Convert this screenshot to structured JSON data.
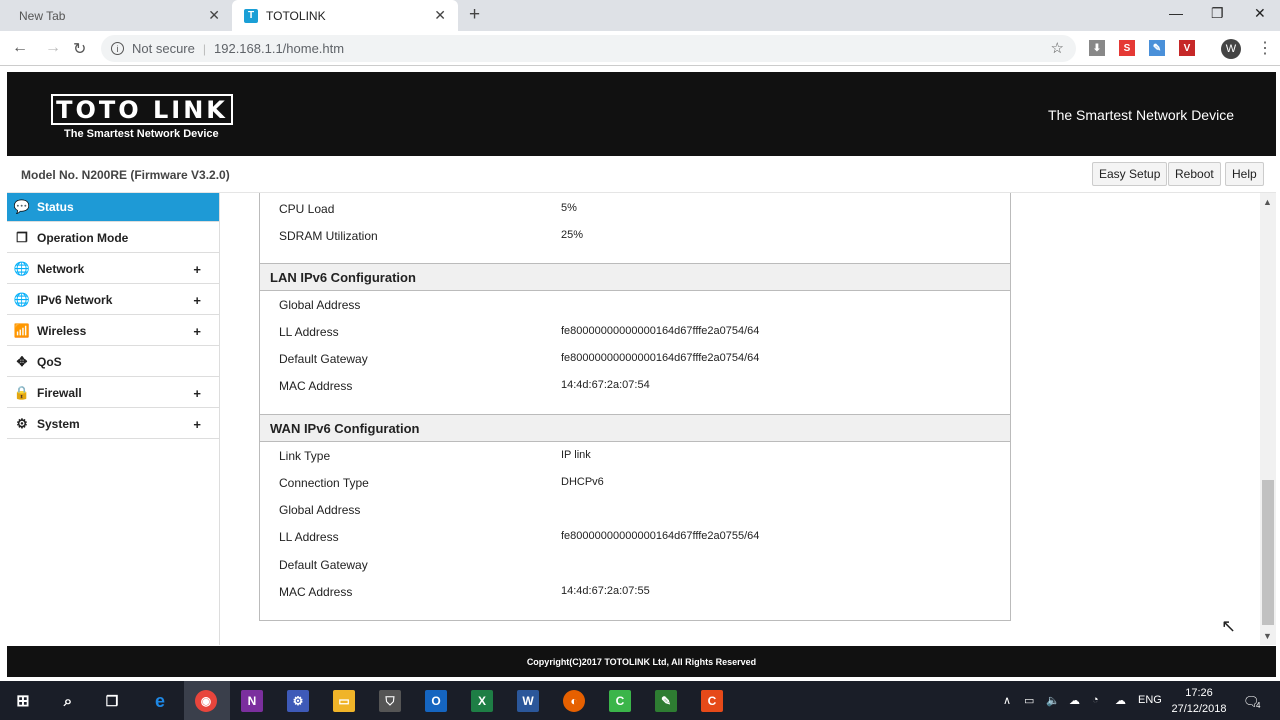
{
  "browser": {
    "tabs": [
      {
        "title": "New Tab"
      },
      {
        "title": "TOTOLINK",
        "favicon": "T"
      }
    ],
    "security_label": "Not secure",
    "url": "192.168.1.1/home.htm",
    "avatar_letter": "W",
    "extensions": [
      "S",
      "V"
    ]
  },
  "header": {
    "logo": "TOTO LINK",
    "logo_tagline": "The Smartest Network Device",
    "tagline": "The Smartest Network Device"
  },
  "toolbar": {
    "model": "Model No. N200RE (Firmware V3.2.0)",
    "easy_setup": "Easy Setup",
    "reboot": "Reboot",
    "help": "Help"
  },
  "sidebar": {
    "items": [
      {
        "label": "Status",
        "icon": "chat-icon",
        "expandable": false,
        "active": true
      },
      {
        "label": "Operation Mode",
        "icon": "windows-icon",
        "expandable": false
      },
      {
        "label": "Network",
        "icon": "globe-icon",
        "expandable": true
      },
      {
        "label": "IPv6 Network",
        "icon": "globe-icon",
        "expandable": true
      },
      {
        "label": "Wireless",
        "icon": "wifi-icon",
        "expandable": true
      },
      {
        "label": "QoS",
        "icon": "qos-icon",
        "expandable": false
      },
      {
        "label": "Firewall",
        "icon": "lock-icon",
        "expandable": true
      },
      {
        "label": "System",
        "icon": "gear-icon",
        "expandable": true
      }
    ],
    "plus": "+"
  },
  "status": {
    "system": [
      {
        "label": "CPU Load",
        "value": "5%"
      },
      {
        "label": "SDRAM Utilization",
        "value": "25%"
      }
    ],
    "lan_ipv6": {
      "title": "LAN IPv6 Configuration",
      "rows": [
        {
          "label": "Global Address",
          "value": ""
        },
        {
          "label": "LL Address",
          "value": "fe80000000000000164d67fffe2a0754/64"
        },
        {
          "label": "Default Gateway",
          "value": "fe80000000000000164d67fffe2a0754/64"
        },
        {
          "label": "MAC Address",
          "value": "14:4d:67:2a:07:54"
        }
      ]
    },
    "wan_ipv6": {
      "title": "WAN IPv6 Configuration",
      "rows": [
        {
          "label": "Link Type",
          "value": "IP link"
        },
        {
          "label": "Connection Type",
          "value": "DHCPv6"
        },
        {
          "label": "Global Address",
          "value": ""
        },
        {
          "label": "LL Address",
          "value": "fe80000000000000164d67fffe2a0755/64"
        },
        {
          "label": "Default Gateway",
          "value": ""
        },
        {
          "label": "MAC Address",
          "value": "14:4d:67:2a:07:55"
        }
      ]
    }
  },
  "footer": {
    "copyright": "Copyright(C)2017 TOTOLINK Ltd, All Rights Reserved"
  },
  "taskbar": {
    "language": "ENG",
    "time": "17:26",
    "date": "27/12/2018",
    "notifications": "4"
  },
  "colors": {
    "accent": "#1e9ad6",
    "header_bg": "#111111"
  }
}
